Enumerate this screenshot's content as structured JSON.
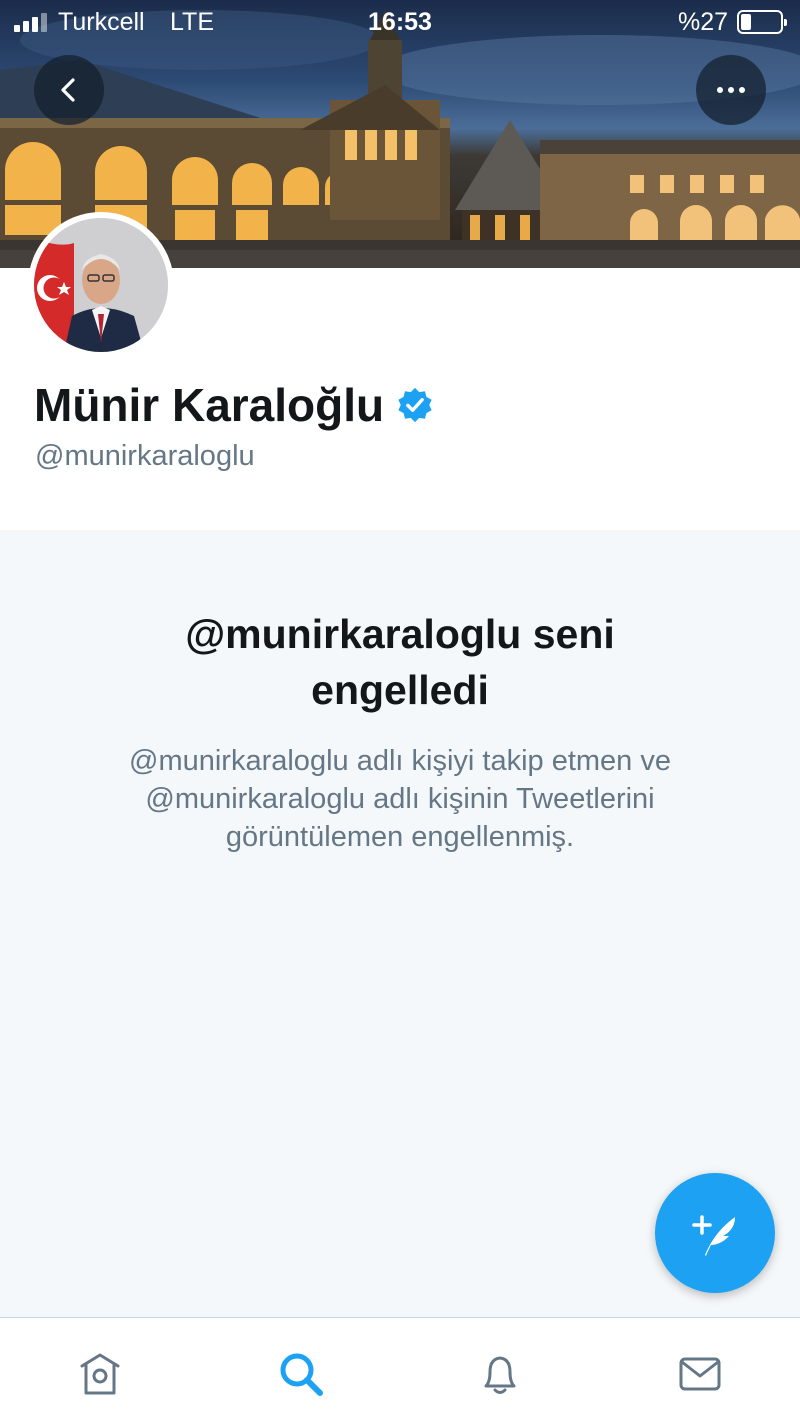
{
  "status_bar": {
    "carrier": "Turkcell",
    "network": "LTE",
    "time": "16:53",
    "battery_text": "%27",
    "battery_level": 0.27
  },
  "header": {
    "back_icon": "chevron-left-icon",
    "more_icon": "more-horizontal-icon"
  },
  "profile": {
    "display_name": "Münir Karaloğlu",
    "handle": "@munirkaraloglu",
    "verified": true
  },
  "blocked": {
    "title": "@munirkaraloglu seni engelledi",
    "description": "@munirkaraloglu adlı kişiyi takip etmen ve @munirkaraloglu adlı kişinin Tweetlerini görüntülemen engellenmiş."
  },
  "compose": {
    "icon": "compose-tweet-icon"
  },
  "tabs": [
    {
      "id": "home",
      "icon": "home-icon",
      "active": false
    },
    {
      "id": "search",
      "icon": "search-icon",
      "active": true
    },
    {
      "id": "notifications",
      "icon": "bell-icon",
      "active": false
    },
    {
      "id": "messages",
      "icon": "mail-icon",
      "active": false
    }
  ],
  "colors": {
    "accent": "#1da1f2",
    "text_primary": "#14171a",
    "text_secondary": "#657786",
    "inactive_icon": "#657786",
    "background": "#f5f8fa"
  }
}
